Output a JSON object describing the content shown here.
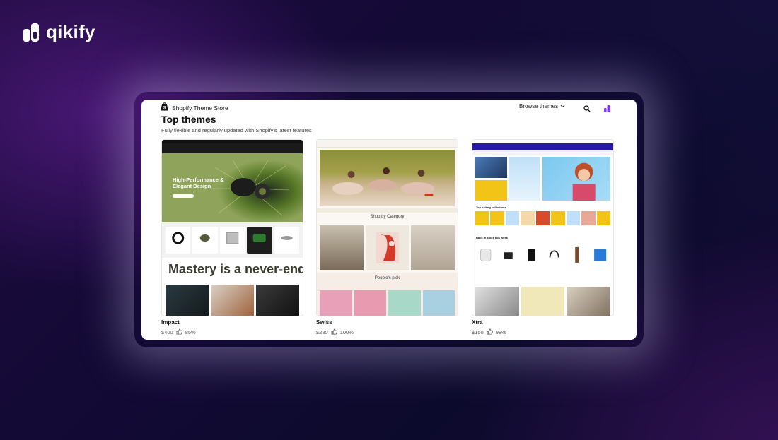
{
  "brand": {
    "name": "qikify"
  },
  "store": {
    "title": "Shopify Theme Store",
    "browse_label": "Browse themes",
    "heading": "Top themes",
    "subheading": "Fully flexible and regularly updated with Shopify's latest features"
  },
  "themes": [
    {
      "name": "Impact",
      "price": "$400",
      "rating": "85%",
      "preview": {
        "hero_text": "High-Performance & Elegant Design",
        "tagline": "Mastery is a never-endin"
      }
    },
    {
      "name": "Swiss",
      "price": "$280",
      "rating": "100%",
      "preview": {
        "section1": "Shop by Category",
        "section2": "People's pick"
      }
    },
    {
      "name": "Xtra",
      "price": "$150",
      "rating": "98%",
      "preview": {
        "section1": "Top selling collections",
        "section2": "Back in stock this week"
      }
    }
  ],
  "icons": {
    "logo": "qikify-logo-icon",
    "store_logo": "shopify-bag-icon",
    "chevron": "chevron-down-icon",
    "search": "search-icon",
    "brand": "qikify-brand-icon",
    "rating": "thumbs-up-icon"
  },
  "colors": {
    "accent": "#6d28d9",
    "background": "#130a35"
  }
}
